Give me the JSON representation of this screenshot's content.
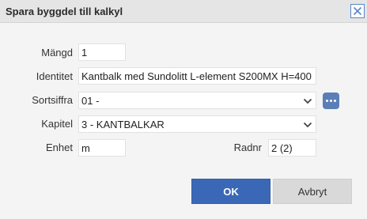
{
  "dialog": {
    "title": "Spara byggdel till kalkyl"
  },
  "form": {
    "quantity": {
      "label": "Mängd",
      "value": "1"
    },
    "identity": {
      "label": "Identitet",
      "value": "Kantbalk med Sundolitt L-element S200MX H=400"
    },
    "sort_number": {
      "label": "Sortsiffra",
      "value": "01 -"
    },
    "chapter": {
      "label": "Kapitel",
      "value": "3 - KANTBALKAR"
    },
    "unit": {
      "label": "Enhet",
      "value": "m"
    },
    "row_number": {
      "label": "Radnr",
      "value": "2 (2)"
    }
  },
  "buttons": {
    "ok": "OK",
    "cancel": "Avbryt"
  },
  "icons": {
    "close": "close-icon",
    "chevron": "chevron-down-icon",
    "more": "more-options-icon"
  },
  "colors": {
    "primary": "#3b68b6",
    "accent_icon": "#5a7fb8"
  }
}
